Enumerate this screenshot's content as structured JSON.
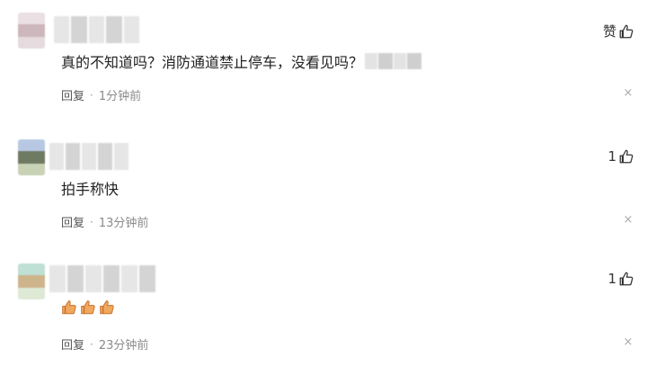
{
  "comments": [
    {
      "text": "真的不知道吗？消防通道禁止停车，没看见吗？",
      "like_label": "赞",
      "like_count": "",
      "reply_label": "回复",
      "separator": "·",
      "time": "1分钟前",
      "close": "×",
      "avatar_colors": [
        "#eadfe2",
        "#cdb6bc",
        "#e5dadd"
      ]
    },
    {
      "text": "拍手称快",
      "like_label": "",
      "like_count": "1",
      "reply_label": "回复",
      "separator": "·",
      "time": "13分钟前",
      "close": "×",
      "avatar_colors": [
        "#b8c8e2",
        "#6f7a63",
        "#c8d2b4"
      ]
    },
    {
      "text": "",
      "emoji_icons": [
        "clap-emoji-icon",
        "clap-emoji-icon",
        "clap-emoji-icon"
      ],
      "like_label": "",
      "like_count": "1",
      "reply_label": "回复",
      "separator": "·",
      "time": "23分钟前",
      "close": "×",
      "avatar_colors": [
        "#bfe0d4",
        "#cdb48b",
        "#dde9d4"
      ]
    }
  ],
  "colors": {
    "text": "#222222",
    "meta": "#8a8a8a",
    "close": "#aaaaaa",
    "accent_emoji": "#e9944a"
  }
}
